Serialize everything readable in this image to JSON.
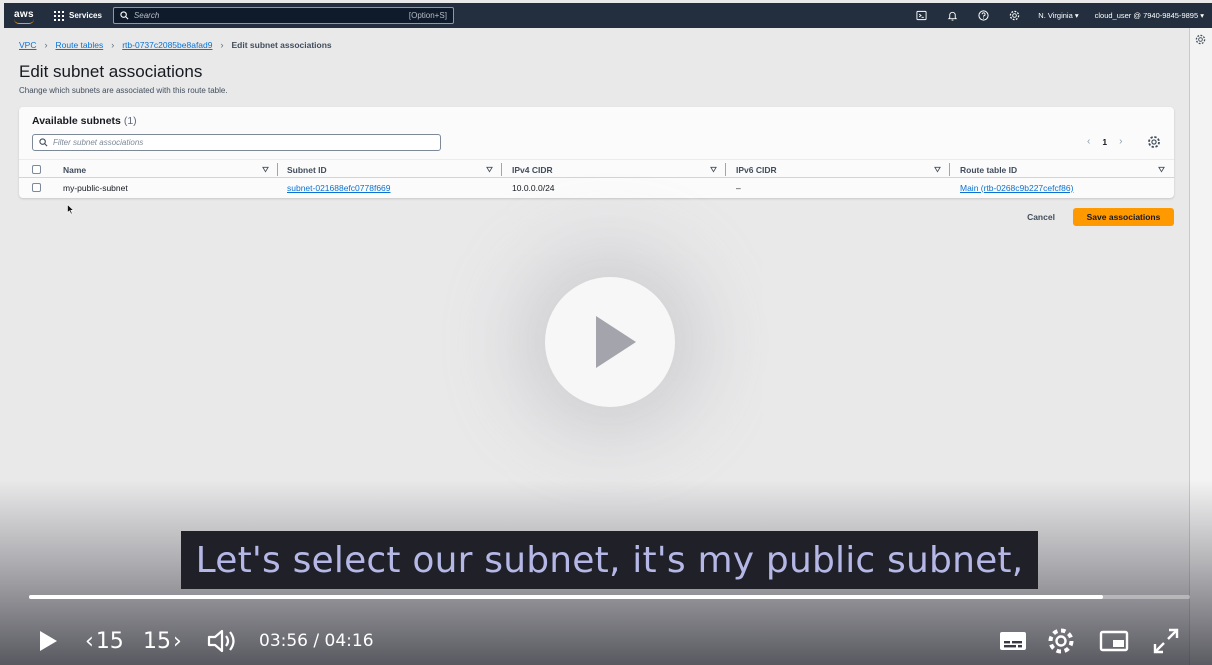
{
  "topnav": {
    "logo": "aws",
    "services_label": "Services",
    "search_placeholder": "Search",
    "search_shortcut": "[Option+S]",
    "region": "N. Virginia",
    "account": "cloud_user @ 7940-9845-9895",
    "icons": [
      "cloudshell-icon",
      "notifications-icon",
      "help-icon",
      "settings-icon"
    ]
  },
  "breadcrumb": {
    "items": [
      "VPC",
      "Route tables",
      "rtb-0737c2085be8afad9"
    ],
    "current": "Edit subnet associations"
  },
  "page": {
    "title": "Edit subnet associations",
    "description": "Change which subnets are associated with this route table."
  },
  "subnets_panel": {
    "title": "Available subnets",
    "count": "(1)",
    "filter_placeholder": "Filter subnet associations",
    "page_number": "1",
    "columns": [
      "Name",
      "Subnet ID",
      "IPv4 CIDR",
      "IPv6 CIDR",
      "Route table ID"
    ],
    "rows": [
      {
        "name": "my-public-subnet",
        "subnet_id": "subnet-021688efc0778f669",
        "ipv4": "10.0.0.0/24",
        "ipv6": "–",
        "route_table": "Main (rtb-0268c9b227cefcf86)"
      }
    ]
  },
  "actions": {
    "cancel": "Cancel",
    "save": "Save associations"
  },
  "video": {
    "caption": "Let's select our subnet, it's my public subnet,",
    "skip_back": "15",
    "skip_forward": "15",
    "current_time": "03:56",
    "separator": " / ",
    "duration": "04:16",
    "progress": 0.925
  },
  "colors": {
    "nav_bg": "#232f3e",
    "link": "#0972d3",
    "primary_button": "#ff9900"
  }
}
